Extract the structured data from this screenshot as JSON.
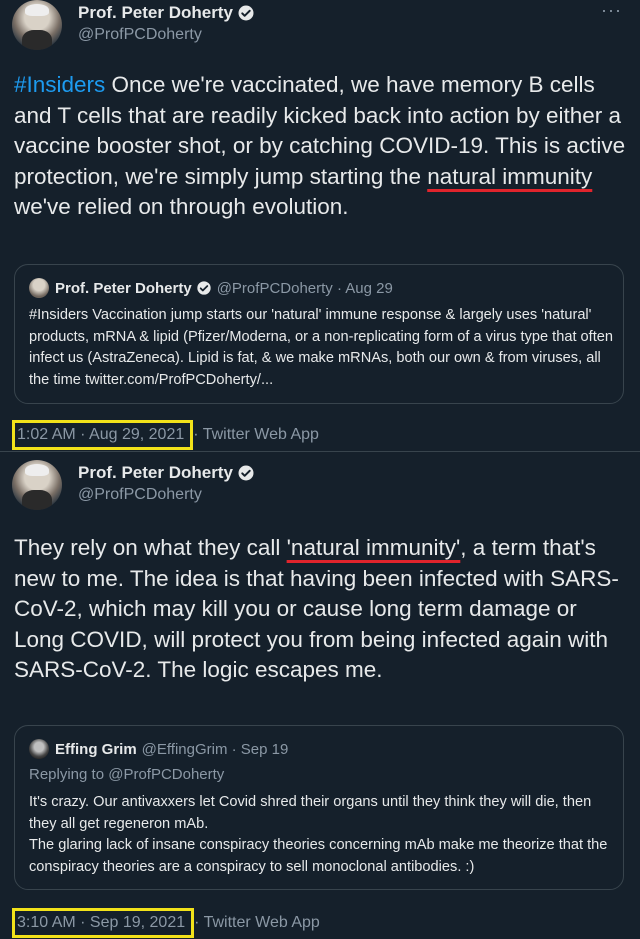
{
  "tweets": [
    {
      "author": "Prof. Peter Doherty",
      "handle": "@ProfPCDoherty",
      "more": "···",
      "text": {
        "hashtag": "#Insiders",
        "part1": " Once we're vaccinated, we have memory B cells and T cells that are readily kicked back into action by either a vaccine booster shot, or by catching COVID-19. This is active protection, we're simply jump starting the ",
        "highlight": "natural immunity",
        "part2": " we've relied on through evolution."
      },
      "quote": {
        "author": "Prof. Peter Doherty",
        "meta": "@ProfPCDoherty · Aug 29",
        "body": "#Insiders Vaccination jump starts our 'natural' immune response & largely uses 'natural' products, mRNA & lipid (Pfizer/Moderna, or a non-replicating form of a virus type  that often infect us (AstraZeneca). Lipid is fat, & we make mRNAs, both our own & from viruses, all the time twitter.com/ProfPCDoherty/..."
      },
      "timestamp": "1:02 AM · Aug 29, 2021",
      "app": " · Twitter Web App"
    },
    {
      "author": "Prof. Peter Doherty",
      "handle": "@ProfPCDoherty",
      "text": {
        "part1": "They rely on what they call ",
        "highlight": "'natural immunity'",
        "part2": ", a term that's new to me. The idea is that having been infected with SARS-CoV-2, which may kill you or cause long term damage or Long COVID, will protect you from being infected again with SARS-CoV-2. The logic escapes me."
      },
      "quote": {
        "author": "Effing Grim",
        "meta": "@EffingGrim · Sep 19",
        "reply": "Replying to @ProfPCDoherty",
        "body_line1": "It's crazy. Our antivaxxers let Covid shred their organs until they think they will die, then they all get regeneron mAb.",
        "body_line2": "The glaring lack of insane conspiracy theories concerning mAb make me theorize that the conspiracy theories are a conspiracy to sell monoclonal antibodies. :)"
      },
      "timestamp": "3:10 AM · Sep 19, 2021",
      "app": " · Twitter Web App"
    }
  ],
  "colors": {
    "background": "#15202b",
    "hashtag": "#1d9bf0",
    "underline": "#e0242c",
    "timestamp_box": "#f2e21a",
    "muted": "#8b98a5"
  }
}
